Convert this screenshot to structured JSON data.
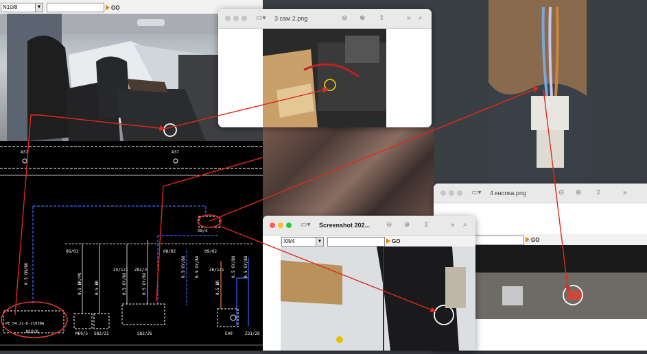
{
  "top_toolbar": {
    "selected": "N10/8",
    "go_label": "GO"
  },
  "mid_toolbar": {
    "selected": "X8/4",
    "go_label": "GO"
  },
  "right_toolbar": {
    "go_label": "GO"
  },
  "windows": {
    "w1": {
      "title": "3 сам 2.png"
    },
    "w2": {
      "title": "4 кнопка.png"
    },
    "w3": {
      "title": "Screenshot 202..."
    }
  },
  "schematic": {
    "labels": {
      "a37_left": "A37",
      "a37_right": "A37",
      "x84": "X8/4",
      "n10_8_part": "PE 54.21-U-2103BA",
      "n10_8": "N10/8",
      "w06_01": "06/01",
      "w08_02": "08/02",
      "w09_02": "09/02",
      "z5_1": "Z5/1z1",
      "z82_3": "Z82/3",
      "z6_1": "Z6/1z1",
      "m69_5": "M69/5",
      "s82_21": "S82/21",
      "s82_26": "S82/26",
      "e40": "E40",
      "z31_28": "Z31/28",
      "wire_1": "0.5 GN/BU",
      "wire_2": "0.5 BR/PK",
      "wire_3": "0.5 BR",
      "wire_4": "0.5 GY/BU",
      "wire_5": "0.5 GY/BU",
      "wire_6": "0.5 GY/BU",
      "wire_7": "0.5 BR",
      "wire_8": "0.5 GY/BU",
      "wire_9": "0.5 GY/BU",
      "wire_10": "0.5 GY/BU"
    }
  },
  "icons": {
    "sidebar": "sidebar-icon",
    "zoom_out": "zoom-out-icon",
    "zoom_in": "zoom-in-icon",
    "share": "share-icon",
    "more": "chevron-double-right-icon",
    "search": "search-icon"
  }
}
